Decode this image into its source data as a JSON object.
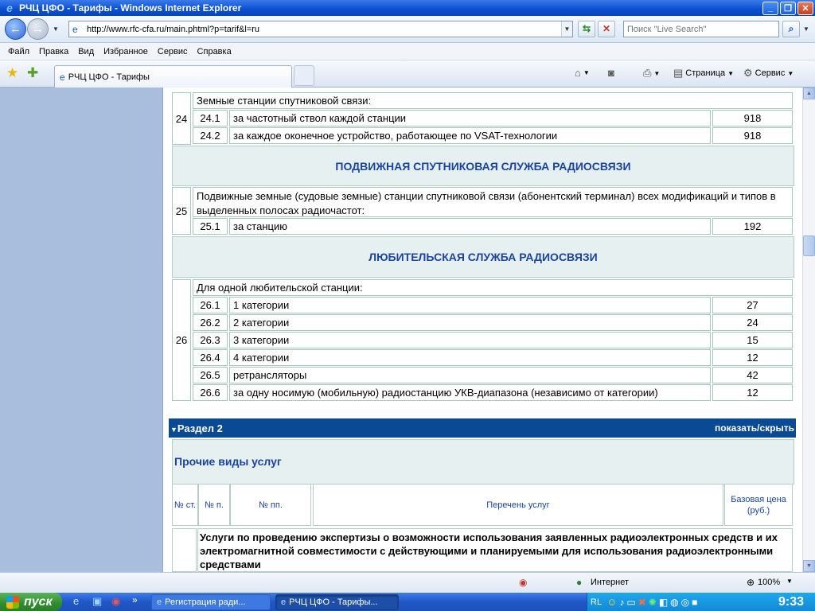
{
  "window": {
    "title": "РЧЦ ЦФО - Тарифы - Windows Internet Explorer"
  },
  "address": {
    "url": "http://www.rfc-cfa.ru/main.phtml?p=tarif&l=ru"
  },
  "search": {
    "placeholder": "Поиск \"Live Search\""
  },
  "menu": [
    "Файл",
    "Правка",
    "Вид",
    "Избранное",
    "Сервис",
    "Справка"
  ],
  "tab": {
    "label": "РЧЦ ЦФО - Тарифы"
  },
  "commandbar": {
    "page_label": "Страница",
    "tools_label": "Сервис"
  },
  "tariffs": {
    "g24": {
      "num": "24",
      "title": "Земные станции спутниковой связи:",
      "items": [
        {
          "sub": "24.1",
          "name": "за частотный ствол каждой станции",
          "price": "918"
        },
        {
          "sub": "24.2",
          "name": "за каждое оконечное устройство, работающее по VSAT-технологии",
          "price": "918"
        }
      ]
    },
    "section_mobile_sat": "ПОДВИЖНАЯ СПУТНИКОВАЯ СЛУЖБА РАДИОСВЯЗИ",
    "g25": {
      "num": "25",
      "title": "Подвижные земные (судовые земные) станции спутниковой связи (абонентский терминал) всех модификаций и типов в выделенных полосах радиочастот:",
      "items": [
        {
          "sub": "25.1",
          "name": "за станцию",
          "price": "192"
        }
      ]
    },
    "section_amateur": "ЛЮБИТЕЛЬСКАЯ СЛУЖБА РАДИОСВЯЗИ",
    "g26": {
      "num": "26",
      "title": "Для одной любительской станции:",
      "items": [
        {
          "sub": "26.1",
          "name": "1 категории",
          "price": "27"
        },
        {
          "sub": "26.2",
          "name": "2 категории",
          "price": "24"
        },
        {
          "sub": "26.3",
          "name": "3 категории",
          "price": "15"
        },
        {
          "sub": "26.4",
          "name": "4 категории",
          "price": "12"
        },
        {
          "sub": "26.5",
          "name": "ретрансляторы",
          "price": "42"
        },
        {
          "sub": "26.6",
          "name": "за одну носимую (мобильную) радиостанцию УКВ-диапазона (независимо от категории)",
          "price": "12"
        }
      ]
    }
  },
  "section2": {
    "header": "Раздел 2",
    "toggle": "показать/скрыть",
    "title": "Прочие виды услуг",
    "columns": {
      "art": "№ ст.",
      "p": "№ п.",
      "pp": "№ пп.",
      "list": "Перечень услуг",
      "price": "Базовая цена (руб.)"
    },
    "first_row": "Услуги по проведению экспертизы о возможности использования заявленных радиоэлектронных средств и их электромагнитной совместимости с действующими и планируемыми для использования радиоэлектронными средствами"
  },
  "status": {
    "zone": "Интернет",
    "zoom": "100%"
  },
  "taskbar": {
    "start": "пуск",
    "tasks": [
      "Регистрация ради...",
      "РЧЦ ЦФО - Тарифы..."
    ],
    "lang": "RL",
    "time": "9:33"
  }
}
